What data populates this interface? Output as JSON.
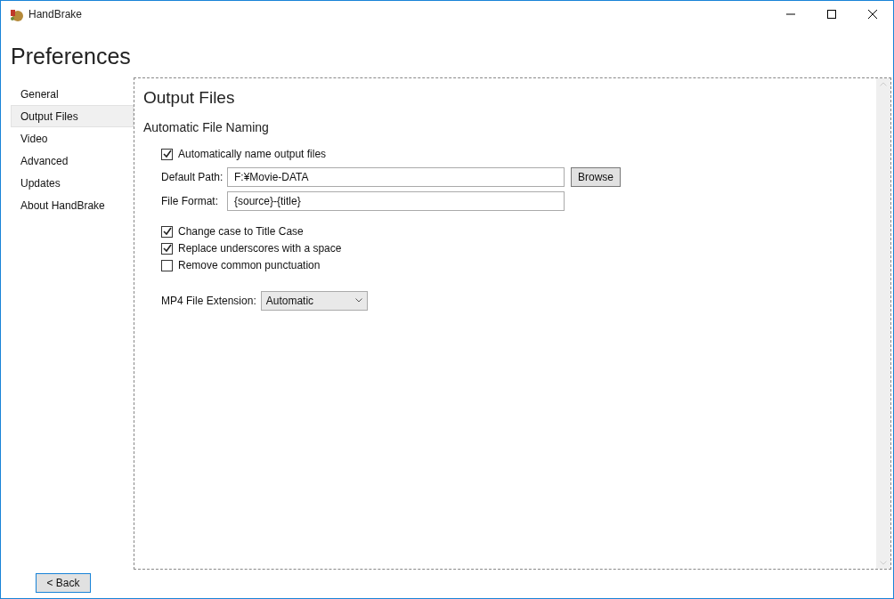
{
  "window": {
    "title": "HandBrake"
  },
  "heading": "Preferences",
  "nav": [
    {
      "label": "General",
      "selected": false
    },
    {
      "label": "Output Files",
      "selected": true
    },
    {
      "label": "Video",
      "selected": false
    },
    {
      "label": "Advanced",
      "selected": false
    },
    {
      "label": "Updates",
      "selected": false
    },
    {
      "label": "About HandBrake",
      "selected": false
    }
  ],
  "panel": {
    "title": "Output Files",
    "section": "Automatic File Naming",
    "auto_name": {
      "label": "Automatically name output files",
      "checked": true
    },
    "default_path": {
      "label": "Default Path:",
      "value": "F:¥Movie-DATA",
      "button": "Browse"
    },
    "file_format": {
      "label": "File Format:",
      "value": "{source}-{title}"
    },
    "options": [
      {
        "label": "Change case to Title Case",
        "checked": true
      },
      {
        "label": "Replace underscores with a space",
        "checked": true
      },
      {
        "label": "Remove common punctuation",
        "checked": false
      }
    ],
    "mp4_extension": {
      "label": "MP4 File Extension:",
      "value": "Automatic"
    }
  },
  "back_button": "< Back"
}
